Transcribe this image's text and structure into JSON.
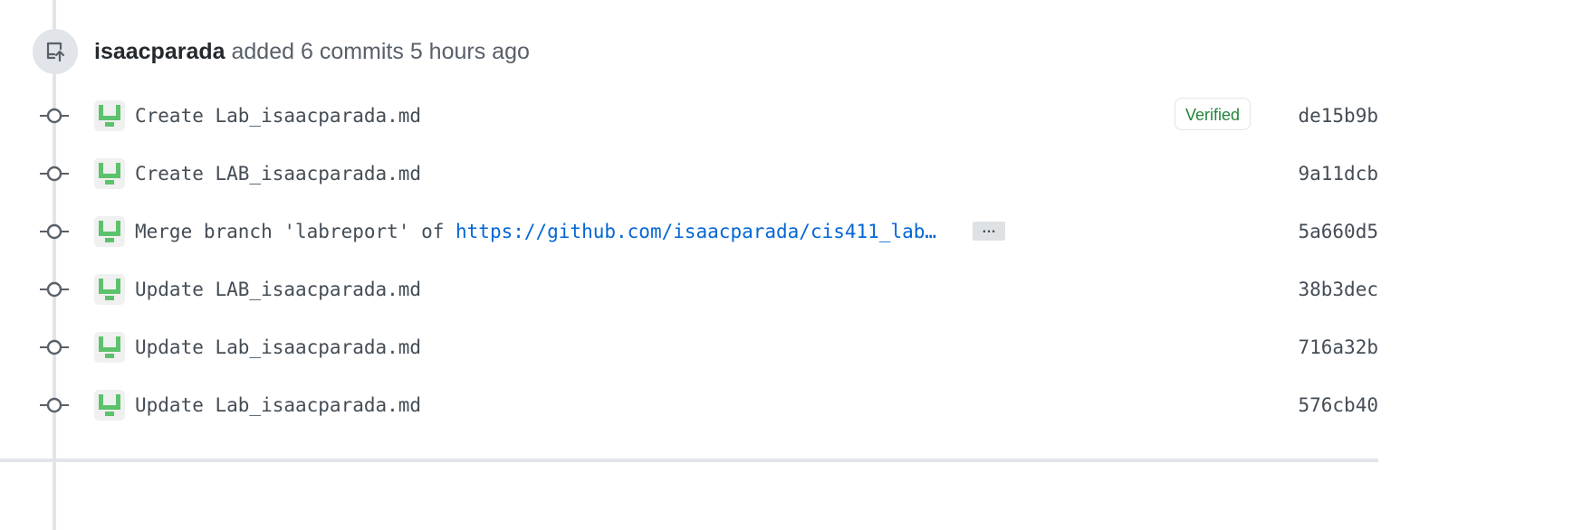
{
  "event": {
    "author": "isaacparada",
    "action": "added 6 commits",
    "time": "5 hours ago",
    "icon": "repo-push-icon"
  },
  "commits": [
    {
      "message": "Create Lab_isaacparada.md",
      "sha": "de15b9b",
      "verified": true
    },
    {
      "message": "Create LAB_isaacparada.md",
      "sha": "9a11dcb",
      "verified": false
    },
    {
      "message": "Merge branch 'labreport' of ",
      "link": "https://github.com/isaacparada/cis411_lab…",
      "sha": "5a660d5",
      "verified": false,
      "has_ellipsis": true
    },
    {
      "message": "Update LAB_isaacparada.md",
      "sha": "38b3dec",
      "verified": false
    },
    {
      "message": "Update Lab_isaacparada.md",
      "sha": "716a32b",
      "verified": false
    },
    {
      "message": "Update Lab_isaacparada.md",
      "sha": "576cb40",
      "verified": false
    }
  ],
  "labels": {
    "verified": "Verified",
    "ellipsis": "…"
  },
  "colors": {
    "avatar_green": "#5cc26b",
    "link": "#0366d6",
    "verified": "#22863a",
    "line": "#e1e4e8"
  }
}
